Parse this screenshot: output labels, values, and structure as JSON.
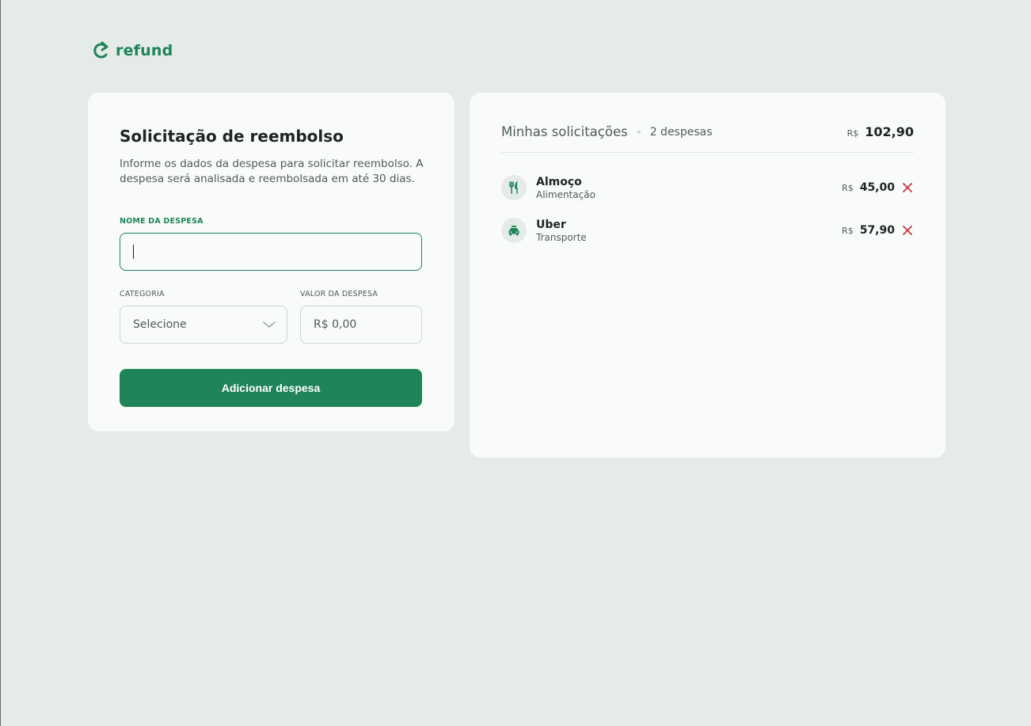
{
  "brand": {
    "name": "refund",
    "icon": "refresh-arrow-icon"
  },
  "form": {
    "title": "Solicitação de reembolso",
    "description": "Informe os dados da despesa para solicitar reembolso. A despesa será analisada e reembolsada em até 30 dias.",
    "name_label": "Nome da despesa",
    "name_value": "",
    "category_label": "Categoria",
    "category_selected": "Selecione",
    "amount_label": "Valor da despesa",
    "amount_placeholder": "R$ 0,00",
    "submit_label": "Adicionar despesa"
  },
  "list": {
    "title": "Minhas solicitações",
    "count_text": "2 despesas",
    "currency": "R$",
    "total": "102,90",
    "items": [
      {
        "name": "Almoço",
        "category": "Alimentação",
        "currency": "R$",
        "amount": "45,00",
        "icon": "fork-knife-icon"
      },
      {
        "name": "Uber",
        "category": "Transporte",
        "currency": "R$",
        "amount": "57,90",
        "icon": "car-icon"
      }
    ]
  },
  "colors": {
    "accent": "#1f8459",
    "danger": "#c7343e",
    "background": "#e4ebe8",
    "card": "#f9fbfa"
  }
}
